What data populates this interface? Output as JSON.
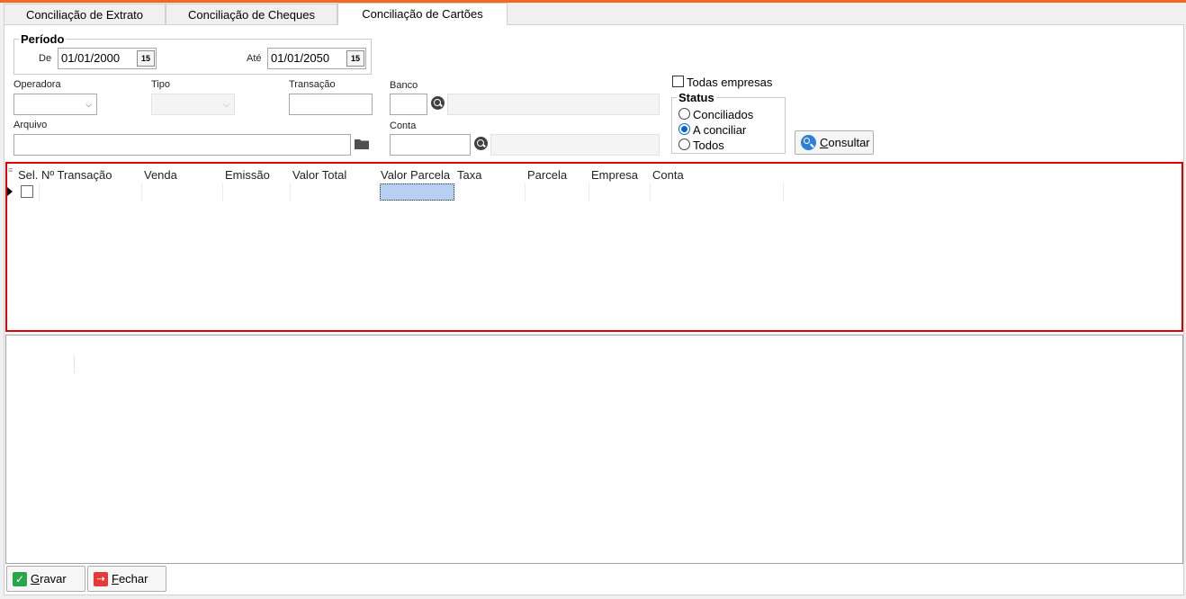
{
  "tabs": [
    {
      "label": "Conciliação de Extrato",
      "active": false
    },
    {
      "label": "Conciliação de Cheques",
      "active": false
    },
    {
      "label": "Conciliação de Cartões",
      "active": true
    }
  ],
  "periodo": {
    "legend": "Período",
    "de_label": "De",
    "de_value": "01/01/2000",
    "ate_label": "Até",
    "ate_value": "01/01/2050",
    "calendar_glyph": "15"
  },
  "filters": {
    "operadora_label": "Operadora",
    "operadora_value": "",
    "tipo_label": "Tipo",
    "tipo_value": "",
    "transacao_label": "Transação",
    "transacao_value": "",
    "banco_label": "Banco",
    "banco_value": "",
    "banco_desc": "",
    "arquivo_label": "Arquivo",
    "arquivo_value": "",
    "conta_label": "Conta",
    "conta_value": "",
    "conta_desc": ""
  },
  "todas_empresas": {
    "label": "Todas empresas",
    "checked": false
  },
  "status": {
    "legend": "Status",
    "options": [
      {
        "label": "Conciliados",
        "selected": false
      },
      {
        "label": "A conciliar",
        "selected": true
      },
      {
        "label": "Todos",
        "selected": false
      }
    ]
  },
  "consultar": {
    "label": "Consultar",
    "mnemonic": "C",
    "rest": "onsultar"
  },
  "grid": {
    "columns": [
      "Sel.",
      "Nº Transação",
      "Venda",
      "Emissão",
      "Valor Total",
      "Valor Parcela",
      "Taxa",
      "Parcela",
      "Empresa",
      "Conta"
    ]
  },
  "footer": {
    "gravar": {
      "mnemonic": "G",
      "rest": "ravar"
    },
    "fechar": {
      "mnemonic": "F",
      "rest": "echar"
    }
  },
  "colors": {
    "accent": "#f26a21",
    "highlight_border": "#e00000",
    "selection": "#b7cff0"
  }
}
